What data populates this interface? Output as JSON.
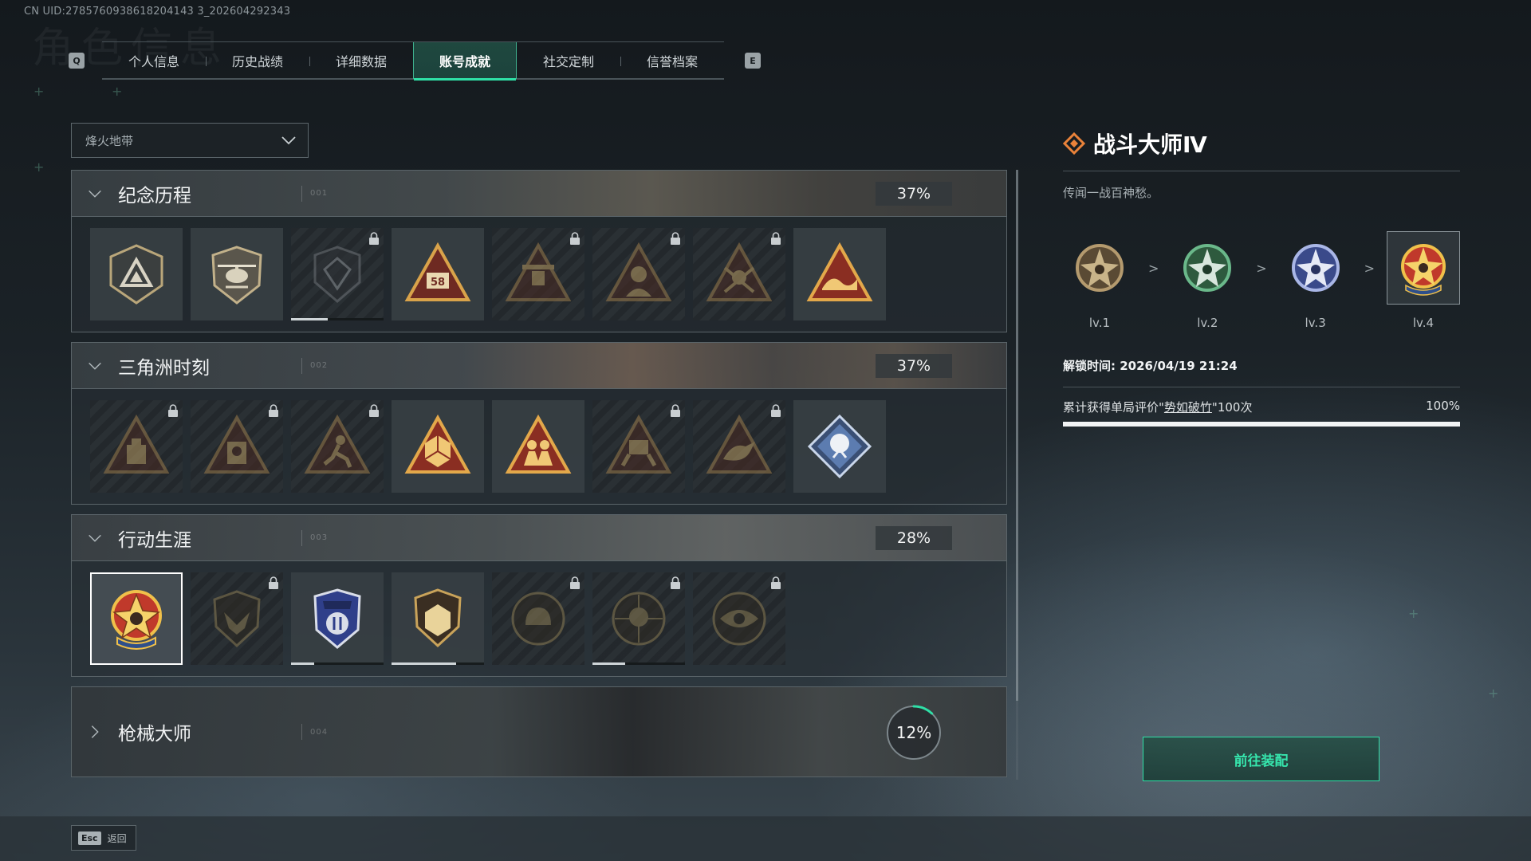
{
  "uid_text": "CN UID:2785760938618204143 3_202604292343",
  "header": {
    "watermark": "角色信息",
    "left_key": "Q",
    "right_key": "E",
    "tabs": [
      {
        "label": "个人信息",
        "active": false
      },
      {
        "label": "历史战绩",
        "active": false
      },
      {
        "label": "详细数据",
        "active": false
      },
      {
        "label": "账号成就",
        "active": true
      },
      {
        "label": "社交定制",
        "active": false
      },
      {
        "label": "信誉档案",
        "active": false
      }
    ]
  },
  "mode_select": {
    "value": "烽火地带",
    "icon": "chevron-down-icon"
  },
  "categories": [
    {
      "title": "纪念历程",
      "code": "001",
      "progress": "37%",
      "expanded": true,
      "badges": [
        {
          "name": "triangle-emblem",
          "locked": false
        },
        {
          "name": "helicopter-emblem",
          "locked": false
        },
        {
          "name": "shield-emblem",
          "locked": true
        },
        {
          "name": "s8-emblem",
          "locked": false
        },
        {
          "name": "s9-emblem",
          "locked": true
        },
        {
          "name": "bust-emblem",
          "locked": true
        },
        {
          "name": "soldier-emblem",
          "locked": true
        },
        {
          "name": "wave-emblem",
          "locked": false
        }
      ]
    },
    {
      "title": "三角洲时刻",
      "code": "002",
      "progress": "37%",
      "expanded": true,
      "badges": [
        {
          "name": "bottle-emblem",
          "locked": true
        },
        {
          "name": "operator-emblem",
          "locked": true
        },
        {
          "name": "runner-emblem",
          "locked": true
        },
        {
          "name": "d20-emblem",
          "locked": false
        },
        {
          "name": "squad-emblem",
          "locked": false
        },
        {
          "name": "mech-emblem",
          "locked": true
        },
        {
          "name": "crow-emblem",
          "locked": true
        },
        {
          "name": "rose-emblem",
          "locked": false
        }
      ]
    },
    {
      "title": "行动生涯",
      "code": "003",
      "progress": "28%",
      "expanded": true,
      "badges": [
        {
          "name": "combat-master-emblem",
          "locked": false,
          "selected": true
        },
        {
          "name": "wing-shield-emblem",
          "locked": true
        },
        {
          "name": "police-shield-emblem",
          "locked": false,
          "progress": 0.25
        },
        {
          "name": "d20-shield-emblem",
          "locked": false,
          "progress": 0.7
        },
        {
          "name": "helmet-emblem",
          "locked": true
        },
        {
          "name": "skull-emblem",
          "locked": true,
          "progress": 0.35
        },
        {
          "name": "eye-emblem",
          "locked": true
        }
      ]
    },
    {
      "title": "枪械大师",
      "code": "004",
      "progress": "12%",
      "progress_value": 0.12,
      "expanded": false
    }
  ],
  "detail": {
    "title": "战斗大师Ⅳ",
    "description": "传闻一战百神愁。",
    "levels": [
      {
        "label": "lv.1",
        "color": "#b49a6e"
      },
      {
        "label": "lv.2",
        "color": "#4f9a6a"
      },
      {
        "label": "lv.3",
        "color": "#6f7fc6"
      },
      {
        "label": "lv.4",
        "color": "#d04a3c",
        "selected": true
      }
    ],
    "unlock_time": "解锁时间: 2026/04/19 21:24",
    "requirement_prefix": "累计获得单局评价\"",
    "requirement_highlight": "势如破竹",
    "requirement_suffix": "\"100次",
    "requirement_progress": "100%",
    "requirement_value": 1.0,
    "equip_button": "前往装配"
  },
  "footer": {
    "esc_key": "Esc",
    "back_label": "返回"
  },
  "colors": {
    "accent": "#2fe0a7",
    "gold": "#c9a35a",
    "dark": "#1b2227"
  }
}
